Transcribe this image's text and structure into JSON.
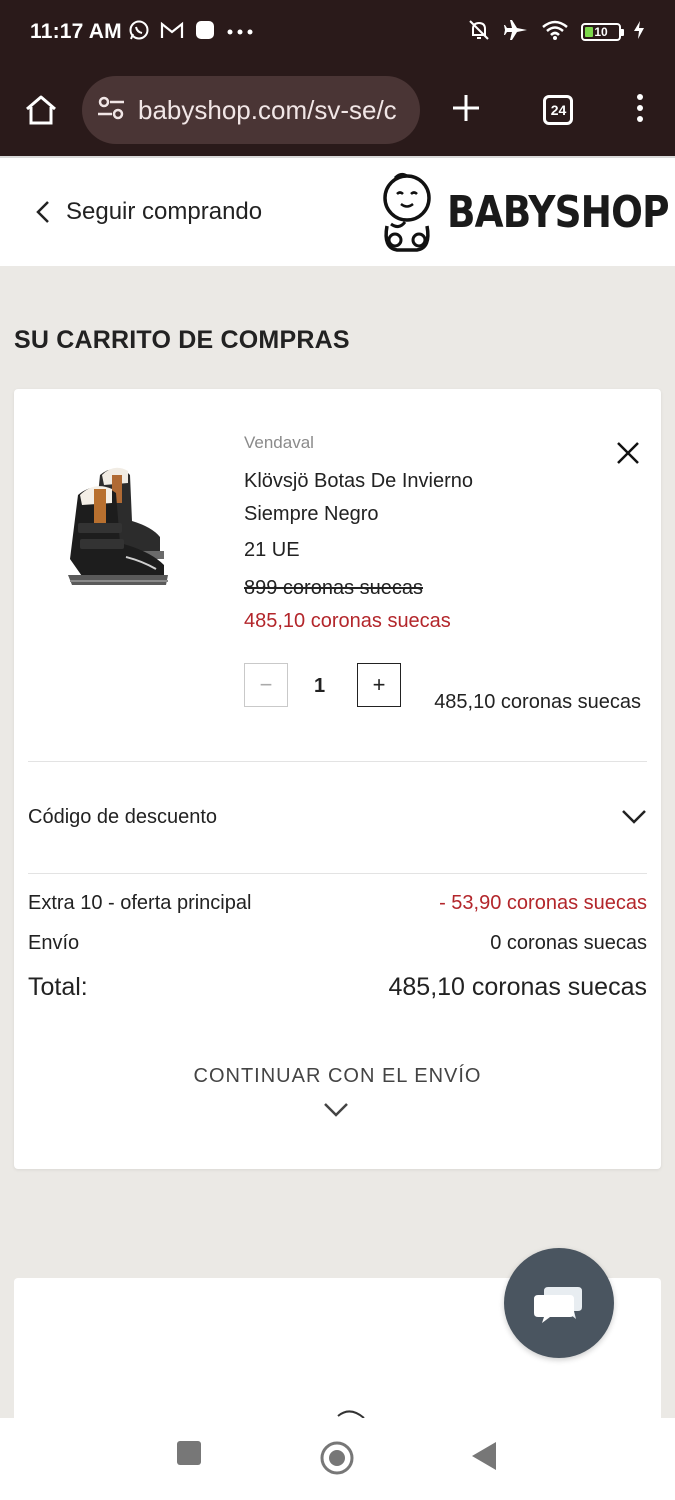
{
  "status_bar": {
    "time": "11:17 AM",
    "battery_level": "10",
    "icons": [
      "whatsapp-icon",
      "gmail-icon",
      "app-icon",
      "more-dots-icon",
      "mute-icon",
      "airplane-icon",
      "wifi-icon",
      "battery-icon",
      "charging-icon"
    ]
  },
  "browser": {
    "url": "babyshop.com/sv-se/c",
    "tab_count": "24"
  },
  "header": {
    "back_label": "Seguir comprando",
    "brand_name": "BABYSHOP"
  },
  "cart": {
    "title": "SU CARRITO DE COMPRAS",
    "item": {
      "brand": "Vendaval",
      "name": "Klövsjö Botas De Invierno Siempre Negro",
      "size": "21 UE",
      "original_price": "899 coronas suecas",
      "sale_price": "485,10 coronas suecas",
      "quantity": "1",
      "line_total": "485,10 coronas suecas",
      "minus_label": "−",
      "plus_label": "+"
    },
    "discount_label": "Código de descuento",
    "summary": {
      "promo_label": "Extra 10 - oferta principal",
      "promo_value": "- 53,90 coronas suecas",
      "shipping_label": "Envío",
      "shipping_value": "0 coronas suecas",
      "total_label": "Total:",
      "total_value": "485,10 coronas suecas"
    },
    "continue_label": "CONTINUAR CON EL ENVÍO"
  },
  "colors": {
    "sale_red": "#b3262b",
    "chrome_dark": "#2a1a1a",
    "page_bg": "#ebe9e5",
    "fab": "#4a5560"
  }
}
